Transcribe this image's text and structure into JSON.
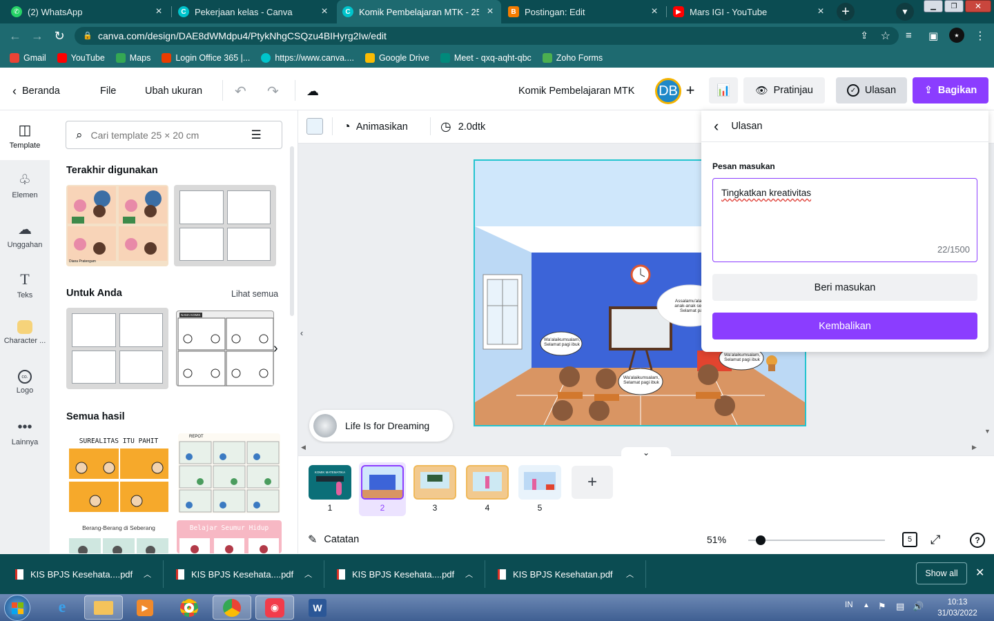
{
  "browser": {
    "tabs": [
      {
        "title": "(2) WhatsApp",
        "icon": "whatsapp-icon",
        "color": "#25d366"
      },
      {
        "title": "Pekerjaan kelas - Canva",
        "icon": "canva-icon",
        "color": "#00c4cc"
      },
      {
        "title": "Komik Pembelajaran MTK - 25 ×",
        "icon": "canva-icon",
        "color": "#00c4cc"
      },
      {
        "title": "Postingan: Edit",
        "icon": "blogger-icon",
        "color": "#f57c00"
      },
      {
        "title": "Mars IGI - YouTube",
        "icon": "youtube-icon",
        "color": "#ff0000"
      }
    ],
    "url": "canva.com/design/DAE8dWMdpu4/PtykNhgCSQzu4BIHyrg2Iw/edit",
    "bookmarks": [
      {
        "label": "Gmail",
        "color": "#ea4335"
      },
      {
        "label": "YouTube",
        "color": "#ff0000"
      },
      {
        "label": "Maps",
        "color": "#34a853"
      },
      {
        "label": "Login Office 365 |...",
        "color": "#eb3c00"
      },
      {
        "label": "https://www.canva....",
        "color": "#00c4cc"
      },
      {
        "label": "Google Drive",
        "color": "#fbbc04"
      },
      {
        "label": "Meet - qxq-aqht-qbc",
        "color": "#00897b"
      },
      {
        "label": "Zoho Forms",
        "color": "#4caf50"
      }
    ]
  },
  "header": {
    "home": "Beranda",
    "file": "File",
    "resize": "Ubah ukuran",
    "title": "Komik Pembelajaran MTK",
    "avatar": "DB",
    "preview": "Pratinjau",
    "review": "Ulasan",
    "share": "Bagikan"
  },
  "rail": [
    {
      "label": "Template",
      "icon": "template-icon"
    },
    {
      "label": "Elemen",
      "icon": "elements-icon"
    },
    {
      "label": "Unggahan",
      "icon": "upload-icon"
    },
    {
      "label": "Teks",
      "icon": "text-icon"
    },
    {
      "label": "Character ...",
      "icon": "character-icon"
    },
    {
      "label": "Logo",
      "icon": "logo-icon"
    },
    {
      "label": "Lainnya",
      "icon": "more-icon"
    }
  ],
  "panel": {
    "search_placeholder": "Cari template 25 × 20 cm",
    "recent_title": "Terakhir digunakan",
    "for_you_title": "Untuk Anda",
    "see_all": "Lihat semua",
    "all_results_title": "Semua hasil",
    "result1_title": "SUREALITAS ITU PAHIT",
    "result2_title": "REPOT",
    "result3_title": "Berang-Berang di Seberang",
    "result4_title": "Belajar Seumur Hidup",
    "comic_caption": "Diana Pratengam",
    "comic_header": "NAMA KOMIK"
  },
  "toolbar": {
    "animate": "Animasikan",
    "duration": "2.0dtk",
    "color_swatch": "#e8f3fb"
  },
  "canvas": {
    "bubble1": "Wa'alaikumsalam, Selamat pagi ibuk",
    "bubble2": "Assalamu'alaikum anak-anak semua, Selamat pagi",
    "bubble3": "Wa'alaikumsalam, Selamat pagi ibuk",
    "bubble4": "Wa'alaikumsalam, Selamat pagi ibuk"
  },
  "music": {
    "title": "Life Is for Dreaming"
  },
  "pages": [
    {
      "num": "1",
      "thumb_text": "KOMIK MATEMATIKA"
    },
    {
      "num": "2"
    },
    {
      "num": "3"
    },
    {
      "num": "4"
    },
    {
      "num": "5"
    }
  ],
  "footer": {
    "notes": "Catatan",
    "zoom": "51%",
    "zoom_value": 0.09,
    "page_count": "5"
  },
  "review_panel": {
    "title": "Ulasan",
    "feedback_label": "Pesan masukan",
    "feedback_value": "Tingkatkan kreativitas",
    "char_count": "22/1500",
    "give_feedback": "Beri masukan",
    "return": "Kembalikan"
  },
  "downloads": {
    "items": [
      "KIS BPJS Kesehata....pdf",
      "KIS BPJS Kesehata....pdf",
      "KIS BPJS Kesehata....pdf",
      "KIS BPJS Kesehatan.pdf"
    ],
    "show_all": "Show all"
  },
  "taskbar": {
    "lang": "IN",
    "time": "10:13",
    "date": "31/03/2022"
  }
}
